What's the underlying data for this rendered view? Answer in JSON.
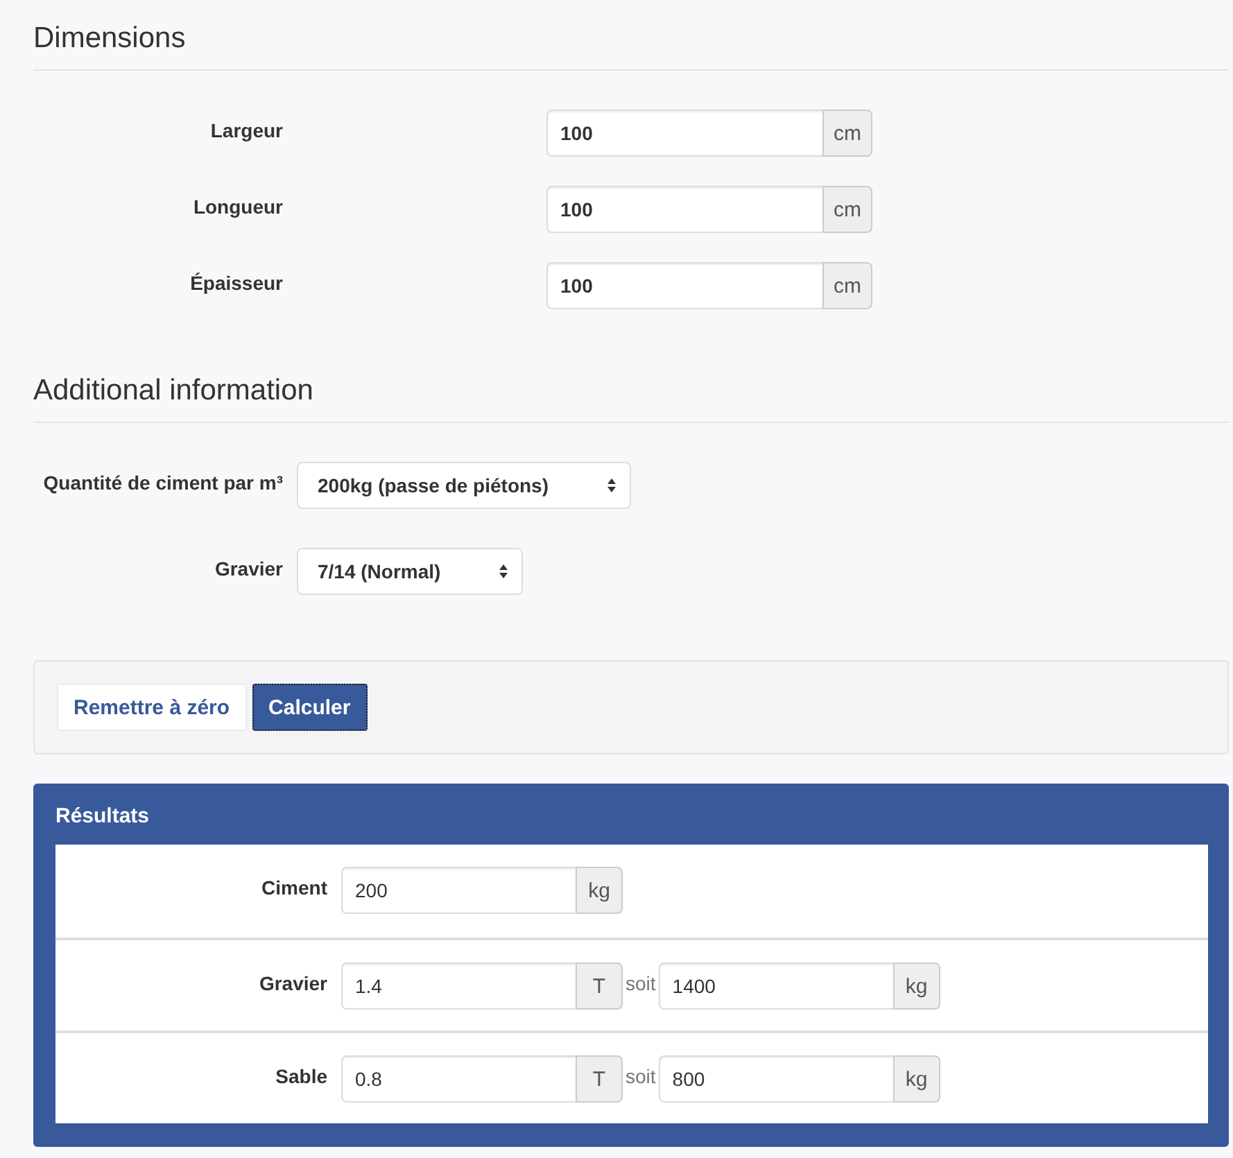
{
  "sections": [
    {
      "title": "Dimensions",
      "fields": [
        {
          "kind": "input",
          "label": "Largeur",
          "value": "100",
          "unit": "cm"
        },
        {
          "kind": "input",
          "label": "Longueur",
          "value": "100",
          "unit": "cm"
        },
        {
          "kind": "input",
          "label": "Épaisseur",
          "value": "100",
          "unit": "cm"
        }
      ]
    },
    {
      "title": "Additional information",
      "fields": [
        {
          "kind": "select",
          "label": "Quantité de ciment par m³",
          "value": "200kg (passe de piétons)"
        },
        {
          "kind": "select",
          "label": "Gravier",
          "value": "7/14 (Normal)"
        }
      ]
    }
  ],
  "actions": [
    {
      "kind": "secondary",
      "label": "Remettre à zéro",
      "focused": false
    },
    {
      "kind": "primary",
      "label": "Calculer",
      "focused": true
    }
  ],
  "results": {
    "title": "Résultats",
    "rows": [
      {
        "label": "Ciment",
        "values": [
          {
            "value": "200",
            "unit": "kg"
          }
        ]
      },
      {
        "label": "Gravier",
        "values": [
          {
            "value": "1.4",
            "unit": "T"
          },
          {
            "value": "1400",
            "unit": "kg"
          }
        ],
        "joiner": "soit"
      },
      {
        "label": "Sable",
        "values": [
          {
            "value": "0.8",
            "unit": "T"
          },
          {
            "value": "800",
            "unit": "kg"
          }
        ],
        "joiner": "soit"
      }
    ]
  }
}
